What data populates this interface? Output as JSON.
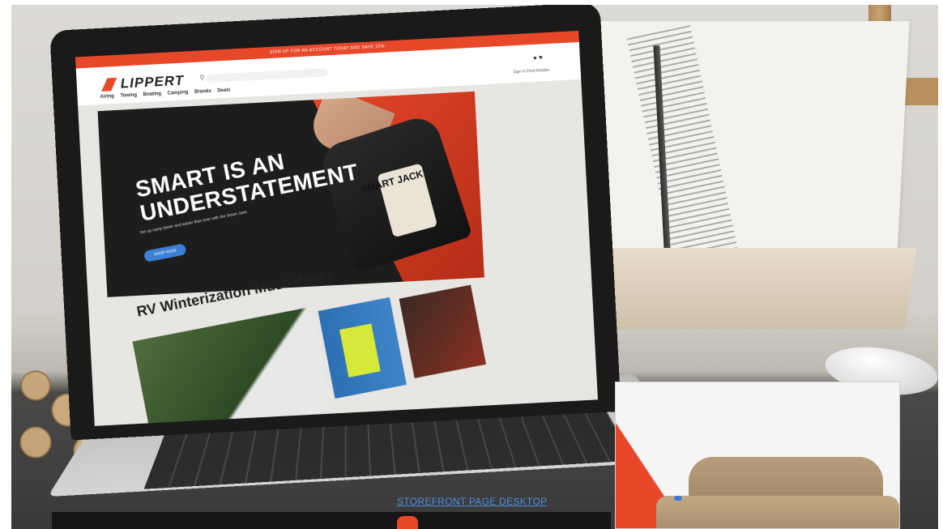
{
  "screen": {
    "promo_text": "SIGN UP FOR AN ACCOUNT TODAY AND SAVE 10%",
    "logo_text": "LIPPERT",
    "search_placeholder": "",
    "util_links": "Sign In   Find Retailer",
    "nav": [
      "Airing",
      "Towing",
      "Boating",
      "Camping",
      "Brands",
      "Deals"
    ],
    "hero": {
      "title_line1": "SMART IS AN",
      "title_line2": "UNDERSTATEMENT",
      "subtitle": "Set up camp faster and easier than ever with the Smart Jack.",
      "button": "SHOP NOW",
      "product_label": "SMART JACK"
    },
    "section_title": "RV Winterization Must-Haves"
  },
  "caption": "STOREFRONT PAGE DESKTOP",
  "colors": {
    "brand": "#e8482a",
    "link": "#4d8fe8"
  }
}
